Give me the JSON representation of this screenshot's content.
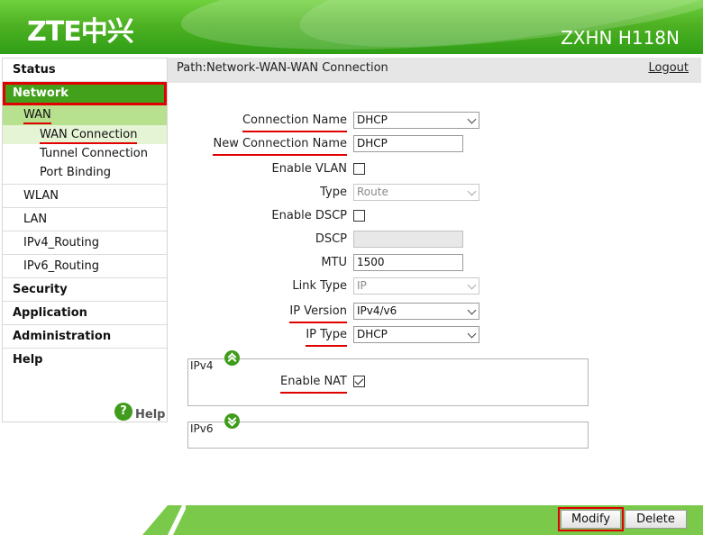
{
  "header": {
    "logo": "ZTE中兴",
    "model": "ZXHN H118N"
  },
  "path": {
    "text": "Path:Network-WAN-WAN Connection",
    "logout": "Logout"
  },
  "sidebar": {
    "status": "Status",
    "network": "Network",
    "wan": "WAN",
    "wan_connection": "WAN Connection",
    "tunnel_connection": "Tunnel Connection",
    "port_binding": "Port Binding",
    "wlan": "WLAN",
    "lan": "LAN",
    "ipv4_routing": "IPv4_Routing",
    "ipv6_routing": "IPv6_Routing",
    "security": "Security",
    "application": "Application",
    "administration": "Administration",
    "help": "Help",
    "help_link": "Help",
    "help_icon_glyph": "?"
  },
  "form": {
    "connection_name": {
      "label": "Connection Name",
      "value": "DHCP"
    },
    "new_connection_name": {
      "label": "New Connection Name",
      "value": "DHCP"
    },
    "enable_vlan": {
      "label": "Enable VLAN",
      "checked": false
    },
    "type": {
      "label": "Type",
      "value": "Route"
    },
    "enable_dscp": {
      "label": "Enable DSCP",
      "checked": false
    },
    "dscp": {
      "label": "DSCP",
      "value": ""
    },
    "mtu": {
      "label": "MTU",
      "value": "1500"
    },
    "link_type": {
      "label": "Link Type",
      "value": "IP"
    },
    "ip_version": {
      "label": "IP Version",
      "value": "IPv4/v6"
    },
    "ip_type": {
      "label": "IP Type",
      "value": "DHCP"
    }
  },
  "ipv4": {
    "title": "IPv4",
    "enable_nat": {
      "label": "Enable NAT",
      "checked": true
    }
  },
  "ipv6": {
    "title": "IPv6"
  },
  "buttons": {
    "modify": "Modify",
    "delete": "Delete"
  },
  "colors": {
    "brand_green": "#43a01a",
    "highlight_red": "#e00000",
    "footer_green": "#7bc94a"
  }
}
